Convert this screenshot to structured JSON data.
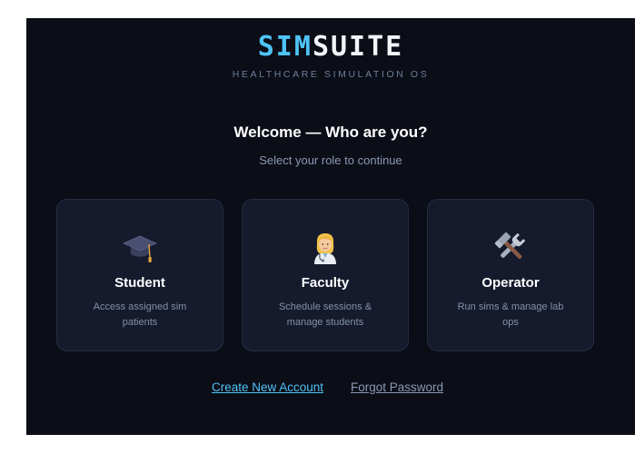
{
  "brand": {
    "logo_part1": "SIM",
    "logo_part2": "SUITE",
    "tagline": "HEALTHCARE SIMULATION OS"
  },
  "heading": {
    "title": "Welcome — Who are you?",
    "subtitle": "Select your role to continue"
  },
  "roles": [
    {
      "icon": "graduation-cap-icon",
      "title": "Student",
      "description": "Access assigned sim patients"
    },
    {
      "icon": "health-worker-icon",
      "title": "Faculty",
      "description": "Schedule sessions & manage students"
    },
    {
      "icon": "tools-icon",
      "title": "Operator",
      "description": "Run sims & manage lab ops"
    }
  ],
  "links": {
    "create_account": "Create New Account",
    "forgot_password": "Forgot Password"
  },
  "colors": {
    "accent": "#4fc3f7",
    "panel_background": "#0b0d17",
    "card_background": "#151b2c"
  }
}
